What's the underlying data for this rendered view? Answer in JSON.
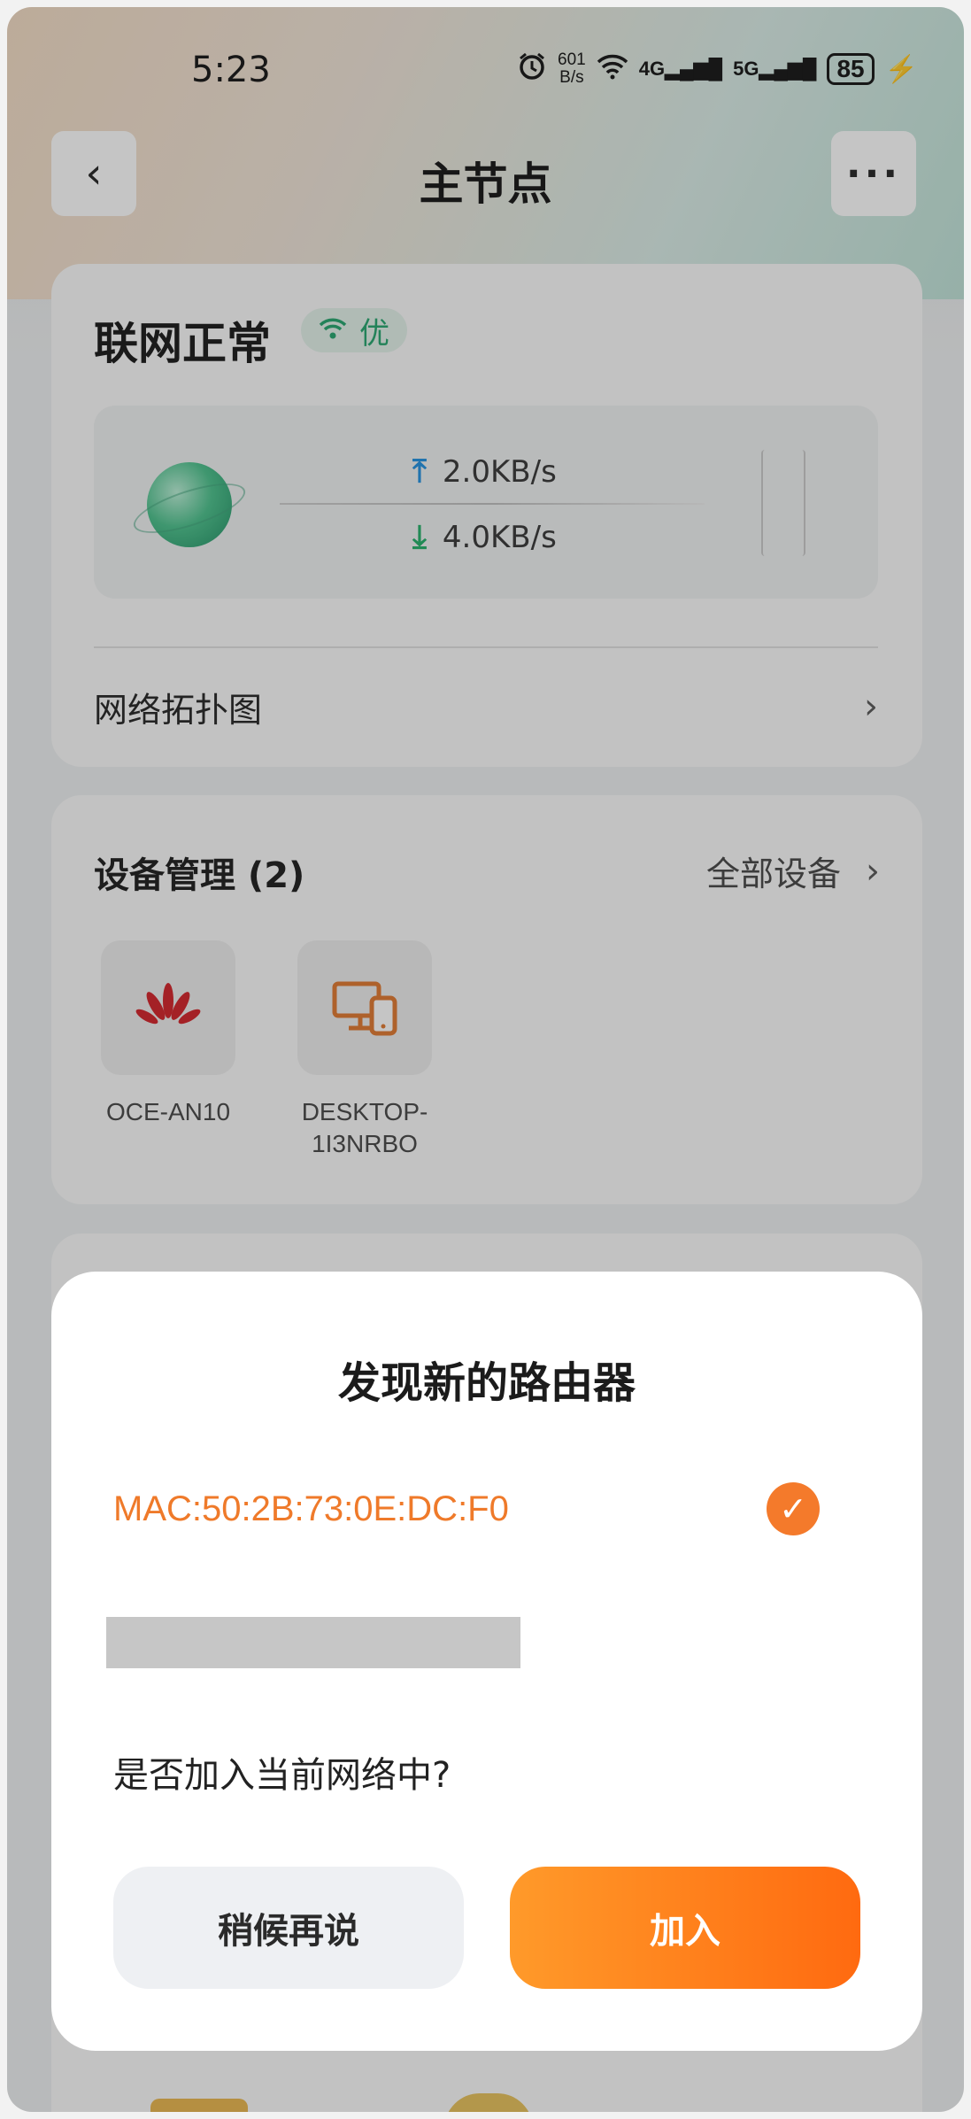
{
  "status_bar": {
    "time": "5:23",
    "speed_value": "601",
    "speed_unit": "B/s",
    "signal1": "4G",
    "signal2": "5G",
    "battery": "85",
    "icons": [
      "alarm-icon",
      "wifi-icon",
      "signal-icon",
      "battery-icon",
      "charging-icon"
    ]
  },
  "header": {
    "title": "主节点",
    "back_icon": "back-icon",
    "more_icon": "more-icon"
  },
  "connection": {
    "status": "联网正常",
    "quality": "优",
    "upload_rate": "2.0KB/s",
    "download_rate": "4.0KB/s",
    "topology_label": "网络拓扑图"
  },
  "devices": {
    "title": "设备管理 (2)",
    "all_label": "全部设备",
    "items": [
      {
        "name": "OCE-AN10",
        "icon": "huawei-logo-icon"
      },
      {
        "name": "DESKTOP-\n1I3NRBO",
        "icon": "computer-phone-icon"
      }
    ]
  },
  "dialog": {
    "title": "发现新的路由器",
    "mac": "MAC:50:2B:73:0E:DC:F0",
    "question": "是否加入当前网络中?",
    "later_label": "稍候再说",
    "join_label": "加入",
    "accent_color": "#f47a2b"
  }
}
